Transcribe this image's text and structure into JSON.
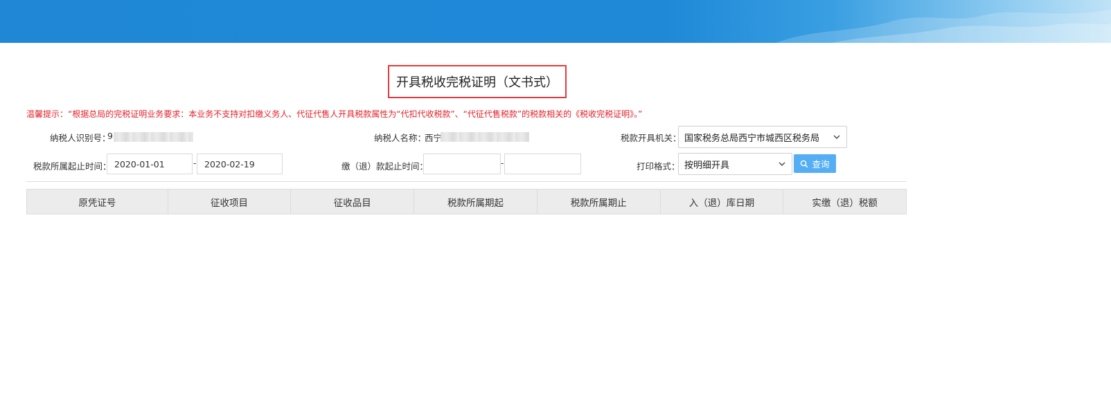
{
  "page_title": "开具税收完税证明（文书式）",
  "notice": "温馨提示：“根据总局的完税证明业务要求：本业务不支持对扣缴义务人、代征代售人开具税款属性为“代扣代收税款”、“代征代售税款”的税款相关的《税收完税证明》。”",
  "form": {
    "taxpayer_id_label": "纳税人识别号：",
    "taxpayer_id_value": "9",
    "taxpayer_name_label": "纳税人名称：",
    "taxpayer_name_value": "西宁",
    "issuing_org_label": "税款开具机关：",
    "issuing_org_value": "国家税务总局西宁市城西区税务局",
    "tax_period_label": "税款所属起止时间：",
    "tax_period_start": "2020-01-01",
    "tax_period_end": "2020-02-19",
    "range_separator": "-",
    "payment_period_label": "缴（退）款起止时间：",
    "payment_period_start": "",
    "payment_period_end": "",
    "print_format_label": "打印格式：",
    "print_format_value": "按明细开具",
    "query_button": "查询"
  },
  "table": {
    "columns": [
      "原凭证号",
      "征收项目",
      "征收品目",
      "税款所属期起",
      "税款所属期止",
      "入（退）库日期",
      "实缴（退）税额"
    ]
  },
  "colors": {
    "banner": "#1f87d6",
    "title_border": "#e4393c",
    "notice_text": "#e4202a",
    "button": "#55aef3"
  }
}
